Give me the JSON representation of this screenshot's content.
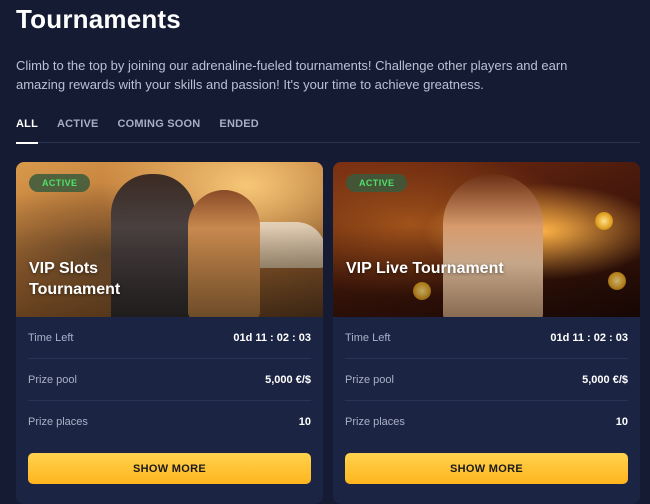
{
  "page": {
    "title": "Tournaments",
    "intro": "Climb to the top by joining our adrenaline-fueled tournaments! Challenge other players and earn amazing rewards with your skills and passion! It's your time to achieve greatness."
  },
  "tabs": [
    {
      "label": "ALL",
      "active": true
    },
    {
      "label": "ACTIVE",
      "active": false
    },
    {
      "label": "COMING SOON",
      "active": false
    },
    {
      "label": "ENDED",
      "active": false
    }
  ],
  "cards": [
    {
      "status": "ACTIVE",
      "title": "VIP Slots Tournament",
      "rows": [
        {
          "label": "Time Left",
          "value": "01d 11 : 02 : 03"
        },
        {
          "label": "Prize pool",
          "value": "5,000 €/$"
        },
        {
          "label": "Prize places",
          "value": "10"
        }
      ],
      "button": "SHOW MORE"
    },
    {
      "status": "ACTIVE",
      "title": "VIP Live Tournament",
      "rows": [
        {
          "label": "Time Left",
          "value": "01d 11 : 02 : 03"
        },
        {
          "label": "Prize pool",
          "value": "5,000 €/$"
        },
        {
          "label": "Prize places",
          "value": "10"
        }
      ],
      "button": "SHOW MORE"
    }
  ],
  "colors": {
    "background": "#141b33",
    "card": "#1c2443",
    "accent": "#ffc23a",
    "badge_text": "#4fe06a"
  }
}
